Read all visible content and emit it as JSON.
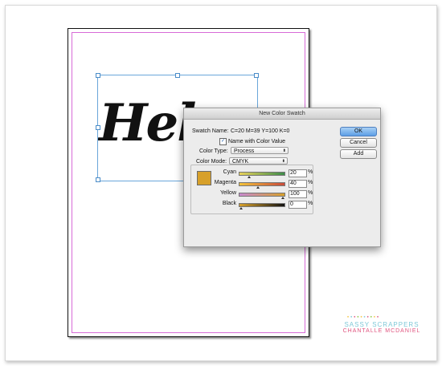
{
  "dialog": {
    "title": "New Color Swatch",
    "swatch_name_label": "Swatch Name:",
    "swatch_name_value": "C=20 M=39 Y=100 K=0",
    "name_with_color_value_label": "Name with Color Value",
    "name_with_color_value_checked": true,
    "color_type_label": "Color Type:",
    "color_type_value": "Process",
    "color_mode_label": "Color Mode:",
    "color_mode_value": "CMYK",
    "swatch_color": "#d7a02a",
    "buttons": {
      "ok": "OK",
      "cancel": "Cancel",
      "add": "Add"
    },
    "sliders": [
      {
        "label": "Cyan",
        "value": "20",
        "unit": "%",
        "level": 0.2
      },
      {
        "label": "Magenta",
        "value": "40",
        "unit": "%",
        "level": 0.4
      },
      {
        "label": "Yellow",
        "value": "100",
        "unit": "%",
        "level": 1.0
      },
      {
        "label": "Black",
        "value": "0",
        "unit": "%",
        "level": 0.0
      }
    ]
  },
  "canvas": {
    "text": "Hel"
  },
  "watermark": {
    "line1": "SASSY SCRAPPERS",
    "line2": "CHANTALLE MCDANIEL"
  },
  "colors": {
    "accent": "#5d9fe6",
    "margin_guide": "#d86bd8",
    "selection": "#6aa6da"
  }
}
